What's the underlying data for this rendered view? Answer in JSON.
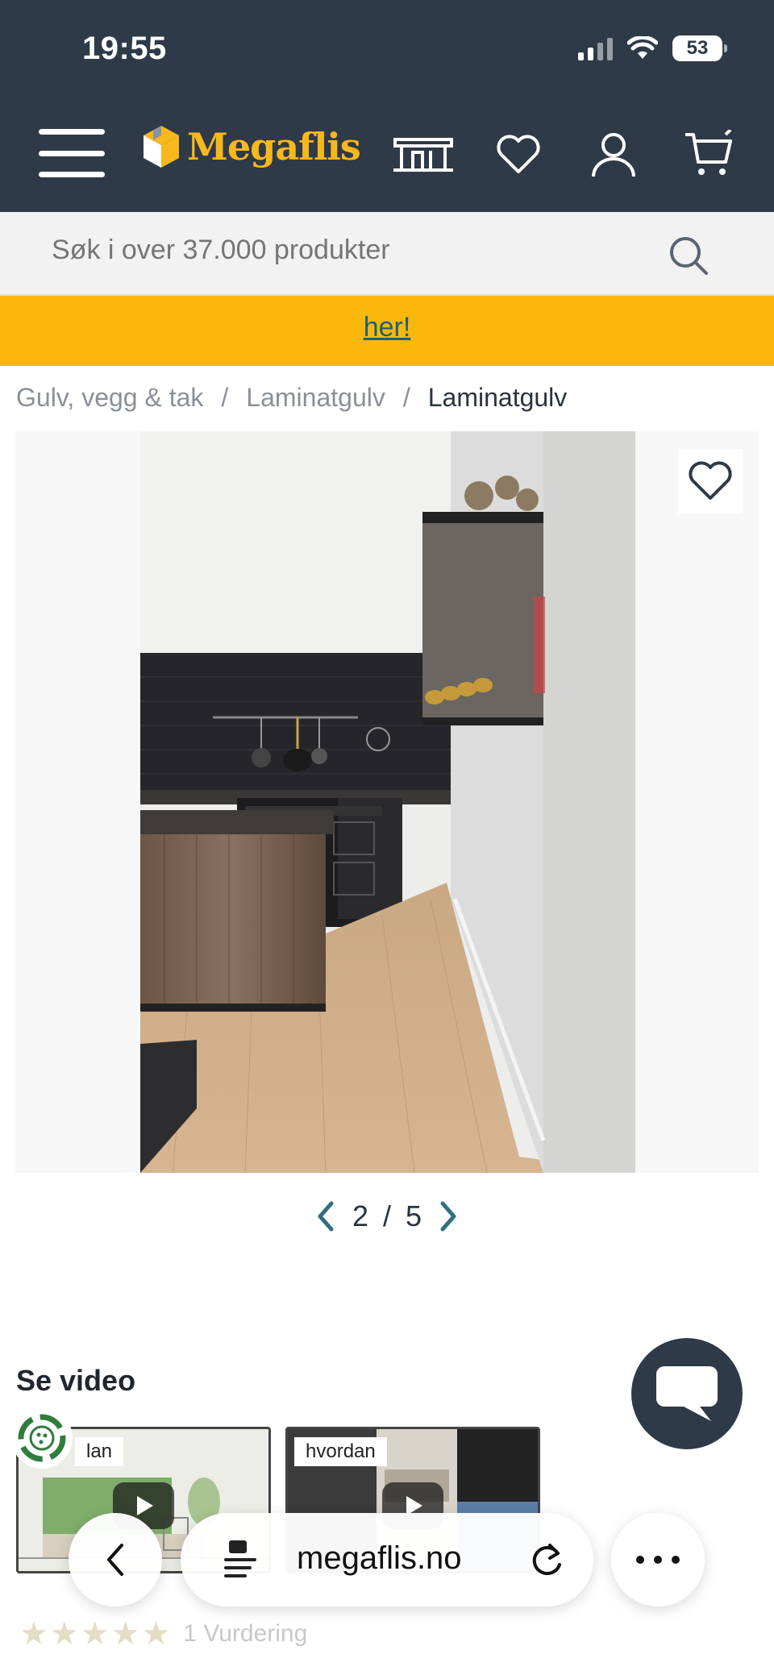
{
  "status_bar": {
    "time": "19:55",
    "battery": "53"
  },
  "header": {
    "logo_text": "Megaflis",
    "icons": [
      "store-icon",
      "heart-icon",
      "user-icon",
      "cart-icon"
    ]
  },
  "search": {
    "placeholder": "Søk i over 37.000 produkter"
  },
  "banner": {
    "link_text": "her!"
  },
  "breadcrumb": {
    "items": [
      "Gulv, vegg & tak",
      "Laminatgulv",
      "Laminatgulv"
    ],
    "separator": "/"
  },
  "gallery": {
    "current": "2",
    "separator": "/",
    "total": "5"
  },
  "video": {
    "title": "Se video",
    "thumbnails": [
      {
        "label": "lan"
      },
      {
        "label": "hvordan"
      }
    ]
  },
  "rating": {
    "stars": 5,
    "text": "1 Vurdering"
  },
  "browser": {
    "url": "megaflis.no"
  },
  "colors": {
    "header_bg": "#2f3a48",
    "brand_yellow": "#f7b81c",
    "banner_bg": "#fbb80c",
    "link_teal": "#1f5f73"
  }
}
